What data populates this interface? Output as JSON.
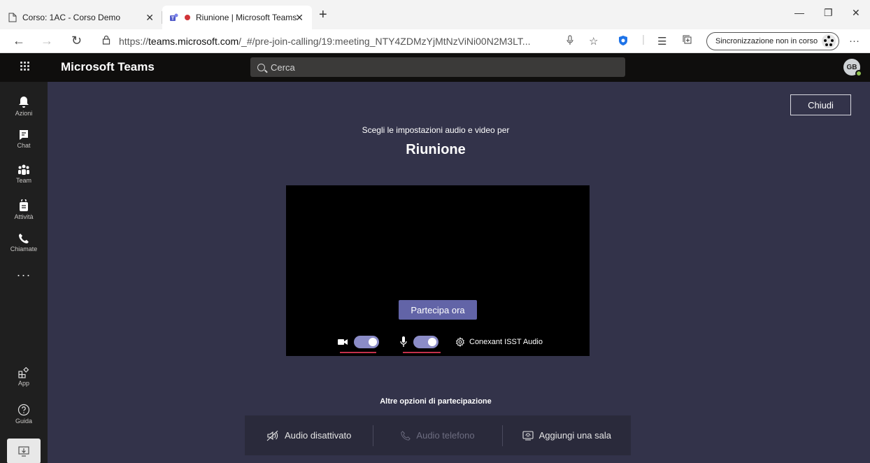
{
  "browser": {
    "tabs": [
      {
        "title": "Corso: 1AC - Corso Demo"
      },
      {
        "title": "Riunione | Microsoft Teams"
      }
    ],
    "address": {
      "url_prefix": "https://",
      "url_host": "teams.microsoft.com",
      "url_path": "/_#/pre-join-calling/19:meeting_NTY4ZDMzYjMtNzViNi00N2M3LT..."
    },
    "sync_status": "Sincronizzazione non in corso",
    "more_menu": "···"
  },
  "teams": {
    "app_name": "Microsoft Teams",
    "search_placeholder": "Cerca",
    "user_initials": "GB"
  },
  "rail": {
    "items": [
      {
        "label": "Azioni",
        "icon": "bell-icon"
      },
      {
        "label": "Chat",
        "icon": "chat-icon"
      },
      {
        "label": "Team",
        "icon": "team-icon"
      },
      {
        "label": "Attività",
        "icon": "assignments-icon"
      },
      {
        "label": "Chiamate",
        "icon": "phone-icon"
      }
    ],
    "more": "···",
    "bottom": [
      {
        "label": "App",
        "icon": "apps-icon"
      },
      {
        "label": "Guida",
        "icon": "help-icon"
      }
    ]
  },
  "prejoin": {
    "close_label": "Chiudi",
    "subtitle": "Scegli le impostazioni audio e video per",
    "meeting_title": "Riunione",
    "join_label": "Partecipa ora",
    "camera_on": true,
    "mic_on": true,
    "audio_device": "Conexant ISST Audio",
    "other_options_title": "Altre opzioni di partecipazione",
    "options": [
      {
        "label": "Audio disattivato",
        "icon": "speaker-off-icon",
        "enabled": true
      },
      {
        "label": "Audio telefono",
        "icon": "phone-icon",
        "enabled": false
      },
      {
        "label": "Aggiungi una sala",
        "icon": "cast-icon",
        "enabled": true
      }
    ]
  },
  "colors": {
    "accent": "#6264a7",
    "toggle_on": "#8b8cc7",
    "annotation_underline": "#c4314b"
  }
}
